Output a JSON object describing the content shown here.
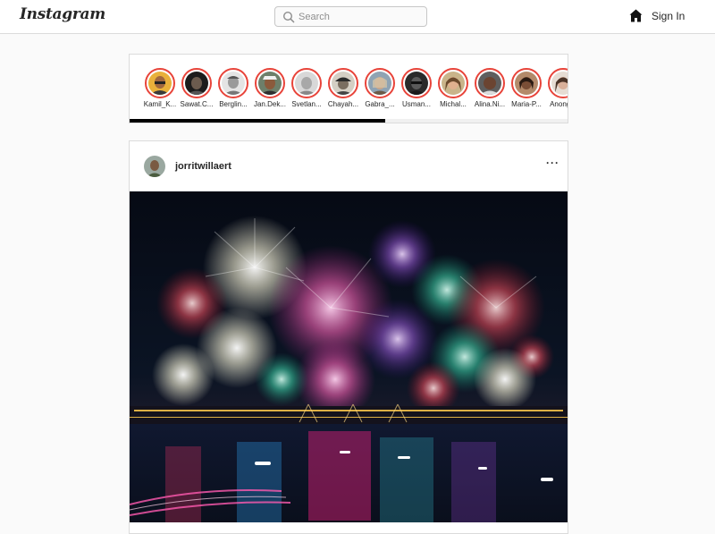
{
  "header": {
    "logo": "Instagram",
    "search_placeholder": "Search",
    "search_value": "",
    "home_icon": "home-icon",
    "signin_label": "Sign In"
  },
  "stories": [
    {
      "name": "Kamil_K..."
    },
    {
      "name": "Sawat.C..."
    },
    {
      "name": "Berglin..."
    },
    {
      "name": "Jan.Dek..."
    },
    {
      "name": "Svetlan..."
    },
    {
      "name": "Chayah..."
    },
    {
      "name": "Gabra_..."
    },
    {
      "name": "Usman..."
    },
    {
      "name": "Michal..."
    },
    {
      "name": "Alina.Ni..."
    },
    {
      "name": "Maria-P..."
    },
    {
      "name": "Anong..."
    }
  ],
  "post": {
    "username": "jorritwillaert",
    "more_label": "···",
    "image_subject": "fireworks-over-harbor-photo"
  },
  "colors": {
    "story_ring": "#e8443a",
    "border": "#dbdbdb",
    "background": "#fafafa"
  }
}
